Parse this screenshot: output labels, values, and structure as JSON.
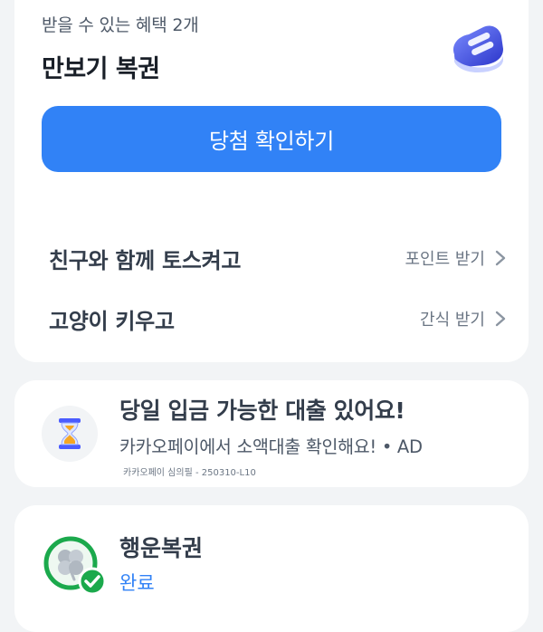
{
  "benefits": {
    "subtitle": "받을 수 있는 혜택 2개",
    "title": "만보기 복권",
    "cta_label": "당첨 확인하기"
  },
  "rows": [
    {
      "label": "친구와 함께 토스켜고",
      "action": "포인트 받기"
    },
    {
      "label": "고양이 키우고",
      "action": "간식 받기"
    }
  ],
  "ad": {
    "title": "당일 입금 가능한 대출 있어요!",
    "description": "카카오페이에서 소액대출 확인해요! • AD",
    "note": "카카오페이 심의필 - 250310-L10"
  },
  "lucky": {
    "title": "행운복권",
    "status": "완료"
  },
  "colors": {
    "accent": "#3182f6",
    "background": "#f2f4f6",
    "success": "#1ba94c"
  },
  "icons": {
    "shoe": "sneaker-icon",
    "hourglass": "hourglass-icon",
    "clover": "clover-icon",
    "check": "check-badge-icon"
  }
}
